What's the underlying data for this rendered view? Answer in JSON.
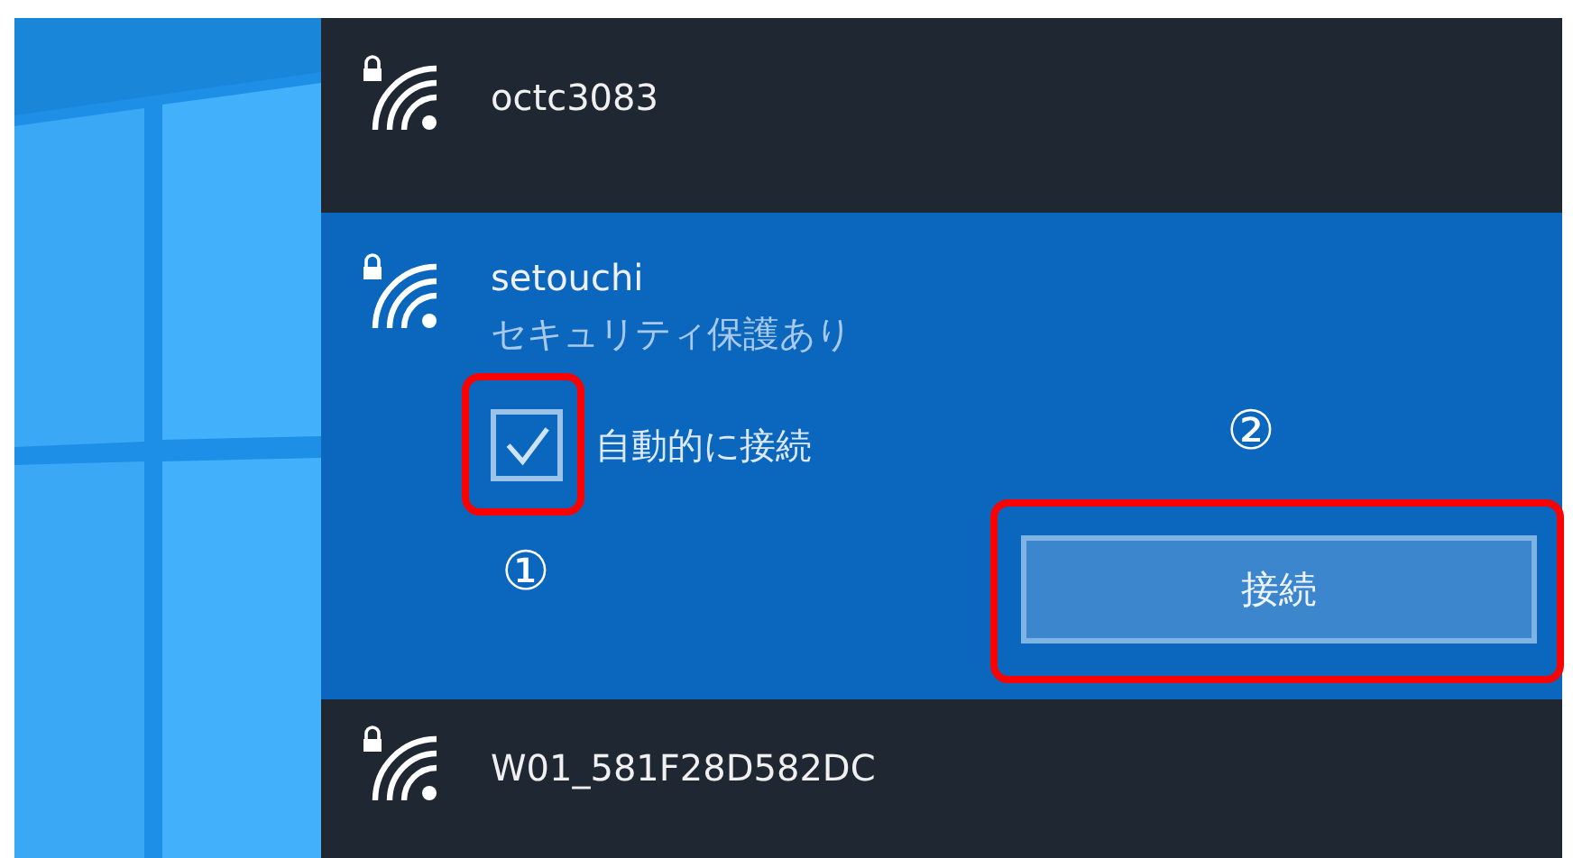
{
  "networks": [
    {
      "name": "octc3083",
      "secured": true,
      "selected": false
    },
    {
      "name": "setouchi",
      "secured": true,
      "selected": true,
      "status": "セキュリティ保護あり",
      "auto_connect": {
        "label": "自動的に接続",
        "checked": true
      },
      "connect_button": "接続"
    },
    {
      "name": "W01_581F28D582DC",
      "secured": true,
      "selected": false
    }
  ],
  "callouts": [
    {
      "number": "①"
    },
    {
      "number": "②"
    }
  ]
}
